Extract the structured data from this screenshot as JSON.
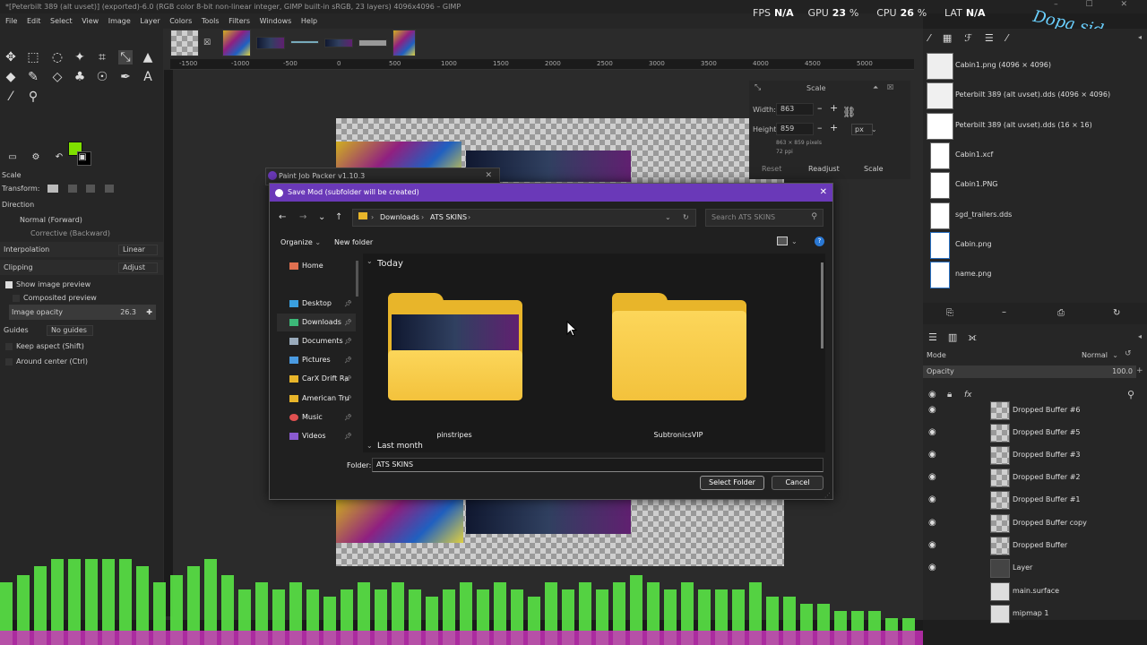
{
  "window": {
    "title": "*[Peterbilt 389 (alt uvset)] (exported)-6.0 (RGB color 8-bit non-linear integer, GIMP built-in sRGB, 23 layers) 4096x4096 – GIMP",
    "controls": "–  ☐  ✕"
  },
  "menu": [
    "File",
    "Edit",
    "Select",
    "View",
    "Image",
    "Layer",
    "Colors",
    "Tools",
    "Filters",
    "Windows",
    "Help"
  ],
  "perf": {
    "fps_label": "FPS",
    "fps": "N/A",
    "gpu_label": "GPU",
    "gpu": "23",
    "cpu_label": "CPU",
    "cpu": "26",
    "lat_label": "LAT",
    "lat": "N/A",
    "pct": "%"
  },
  "watermark": "Dopa sides",
  "colors": {
    "foreground": "#7fe000",
    "background": "#000000",
    "accent": "#6a39b8"
  },
  "tool_options": {
    "title": "Scale",
    "transform_label": "Transform:",
    "direction_label": "Direction",
    "direction_normal": "Normal (Forward)",
    "direction_corrective": "Corrective (Backward)",
    "interpolation_label": "Interpolation",
    "interpolation_value": "Linear",
    "clipping_label": "Clipping",
    "clipping_value": "Adjust",
    "show_preview": "Show image preview",
    "composited_preview": "Composited preview",
    "image_opacity_label": "Image opacity",
    "image_opacity_value": "26.3",
    "guides_label": "Guides",
    "guides_value": "No guides",
    "keep_aspect": "Keep aspect (Shift)",
    "around_center": "Around center (Ctrl)"
  },
  "ruler_ticks": [
    "-1500",
    "-1000",
    "-500",
    "0",
    "500",
    "1000",
    "1500",
    "2000",
    "2500",
    "3000",
    "3500",
    "4000",
    "4500",
    "5000"
  ],
  "scale_dialog": {
    "title": "Scale",
    "width_label": "Width:",
    "width": "863",
    "height_label": "Height:",
    "height": "859",
    "info1": "863 × 859 pixels",
    "info2": "72 ppi",
    "unit": "px",
    "reset": "Reset",
    "readjust": "Readjust",
    "scale": "Scale"
  },
  "images_panel": [
    {
      "name": "Cabin1.png (4096 × 4096)"
    },
    {
      "name": "Peterbilt 389 (alt uvset).dds (4096 × 4096)"
    },
    {
      "name": "Peterbilt 389 (alt uvset).dds (16 × 16)"
    },
    {
      "name": "Cabin1.xcf"
    },
    {
      "name": "Cabin1.PNG"
    },
    {
      "name": "sgd_trailers.dds"
    },
    {
      "name": "Cabin.png"
    },
    {
      "name": "name.png"
    }
  ],
  "layers_panel": {
    "mode_label": "Mode",
    "mode_value": "Normal",
    "opacity_label": "Opacity",
    "opacity_value": "100.0",
    "layers": [
      "Dropped Buffer #6",
      "Dropped Buffer #5",
      "Dropped Buffer #3",
      "Dropped Buffer #2",
      "Dropped Buffer #1",
      "Dropped Buffer copy",
      "Dropped Buffer",
      "Layer",
      "main.surface",
      "mipmap 1"
    ]
  },
  "pjp": {
    "title": "Paint Job Packer v1.10.3"
  },
  "save_dialog": {
    "title": "Save Mod (subfolder will be created)",
    "path": [
      "Downloads",
      "ATS SKINS"
    ],
    "search_placeholder": "Search ATS SKINS",
    "organize": "Organize",
    "new_folder": "New folder",
    "sidebar": [
      "Home",
      "Desktop",
      "Downloads",
      "Documents",
      "Pictures",
      "CarX Drift Ra",
      "American Tru",
      "Music",
      "Videos"
    ],
    "group_today": "Today",
    "group_last_month": "Last month",
    "folders": [
      "pinstripes",
      "SubtronicsVIP"
    ],
    "folder_label": "Folder:",
    "folder_value": "ATS SKINS",
    "select_button": "Select Folder",
    "cancel_button": "Cancel"
  }
}
